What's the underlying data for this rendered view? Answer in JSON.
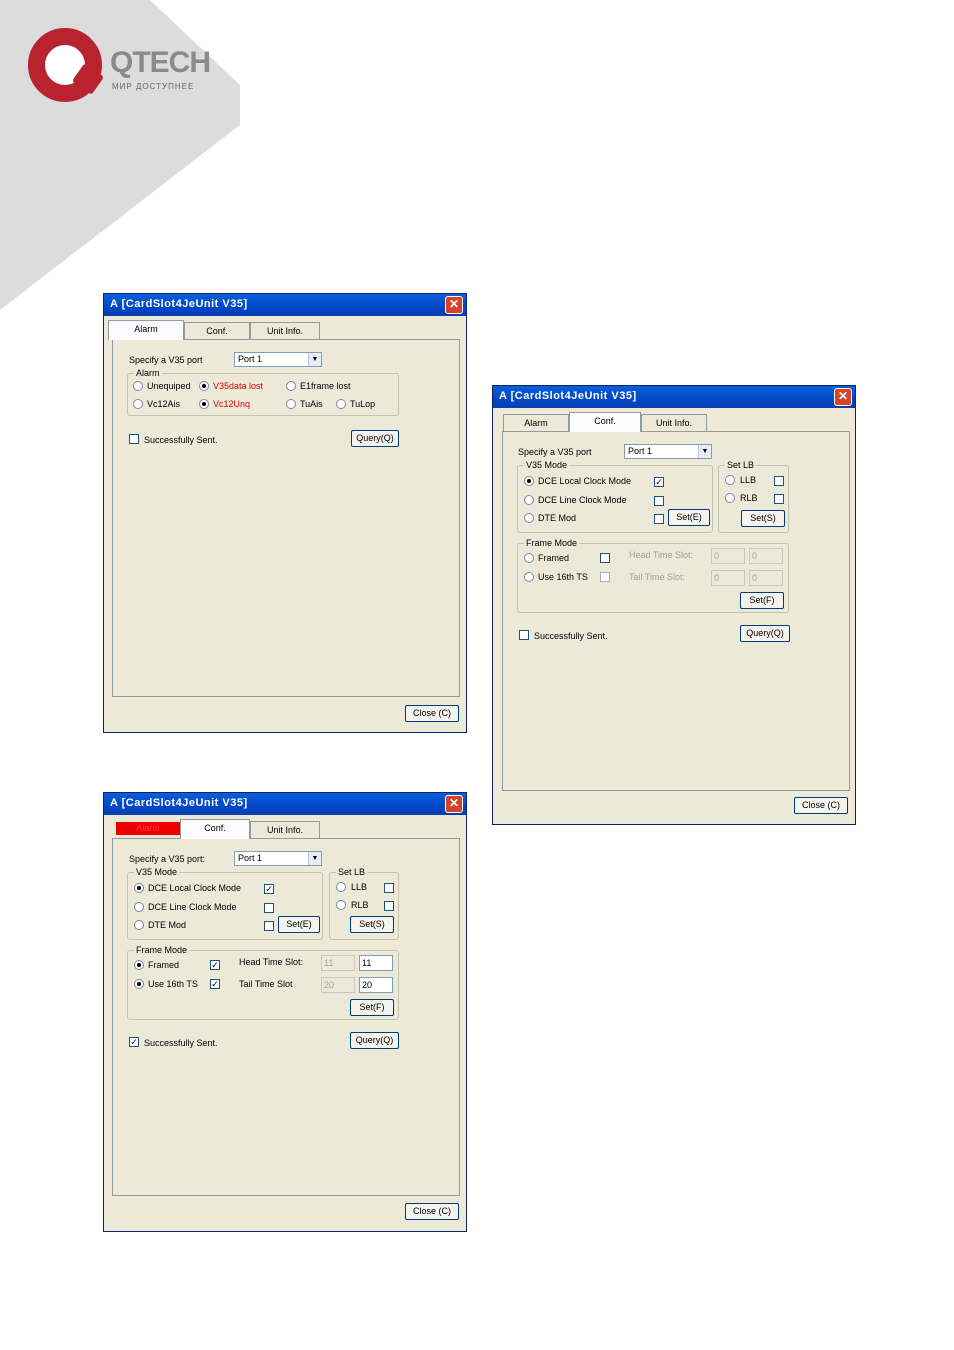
{
  "logo": {
    "brand": "QTECH",
    "tagline": "МИР ДОСТУПНЕЕ"
  },
  "colors": {
    "titlebar": "#0047c8",
    "close_red": "#d5432a",
    "alarm_red": "#e00000",
    "window_bg": "#ece9d8"
  },
  "window1": {
    "title": "A  [CardSlot4JeUnit V35]",
    "close_icon": "✕",
    "tabs": {
      "alarm": "Alarm",
      "conf": "Conf.",
      "unit": "Unit Info."
    },
    "specify_label": "Specify a V35 port",
    "port_value": "Port 1",
    "alarm_group": "Alarm",
    "alarms": {
      "unequiped": "Unequiped",
      "v35data_lost": "V35data lost",
      "e1frame_lost": "E1frame lost",
      "vc12ais": "Vc12Ais",
      "vc12unq": "Vc12Unq",
      "tuais": "TuAis",
      "tulop": "TuLop"
    },
    "successfully_sent": "Successfully Sent.",
    "query_button": "Query(Q)",
    "close_button": "Close (C)"
  },
  "window2": {
    "title": "A  [CardSlot4JeUnit V35]",
    "close_icon": "✕",
    "tabs": {
      "alarm": "Alarm",
      "conf": "Conf.",
      "unit": "Unit Info."
    },
    "specify_label": "Specify a V35 port",
    "port_value": "Port 1",
    "v35_mode_group": "V35 Mode",
    "dce_local": "DCE Local Clock Mode",
    "dce_line": "DCE Line Clock Mode",
    "dte_mode": "DTE Mod",
    "set_e": "Set(E)",
    "set_lb_group": "Set LB",
    "llb": "LLB",
    "rlb": "RLB",
    "set_s": "Set(S)",
    "frame_mode_group": "Frame Mode",
    "framed": "Framed",
    "use16": "Use 16th TS",
    "head_slot": "Head Time Slot:",
    "tail_slot": "Tail Time Slot:",
    "head_a": "0",
    "head_b": "0",
    "tail_a": "0",
    "tail_b": "0",
    "set_f": "Set(F)",
    "successfully_sent": "Successfully Sent.",
    "query_button": "Query(Q)",
    "close_button": "Close (C)",
    "check_mark": "✓"
  },
  "window3": {
    "title": "A  [CardSlot4JeUnit V35]",
    "close_icon": "✕",
    "tabs": {
      "alarm": "Alarm",
      "conf": "Conf.",
      "unit": "Unit Info."
    },
    "specify_label": "Specify a V35 port:",
    "port_value": "Port 1",
    "v35_mode_group": "V35 Mode",
    "dce_local": "DCE Local Clock Mode",
    "dce_line": "DCE Line Clock Mode",
    "dte_mode": "DTE Mod",
    "set_e": "Set(E)",
    "set_lb_group": "Set LB",
    "llb": "LLB",
    "rlb": "RLB",
    "set_s": "Set(S)",
    "frame_mode_group": "Frame Mode",
    "framed": "Framed",
    "use16": "Use 16th TS",
    "head_slot": "Head Time Slot:",
    "tail_slot": "Tail Time Slot",
    "head_a": "11",
    "head_b": "11",
    "tail_a": "20",
    "tail_b": "20",
    "set_f": "Set(F)",
    "successfully_sent": "Successfully Sent.",
    "query_button": "Query(Q)",
    "close_button": "Close (C)",
    "check_mark": "✓"
  }
}
